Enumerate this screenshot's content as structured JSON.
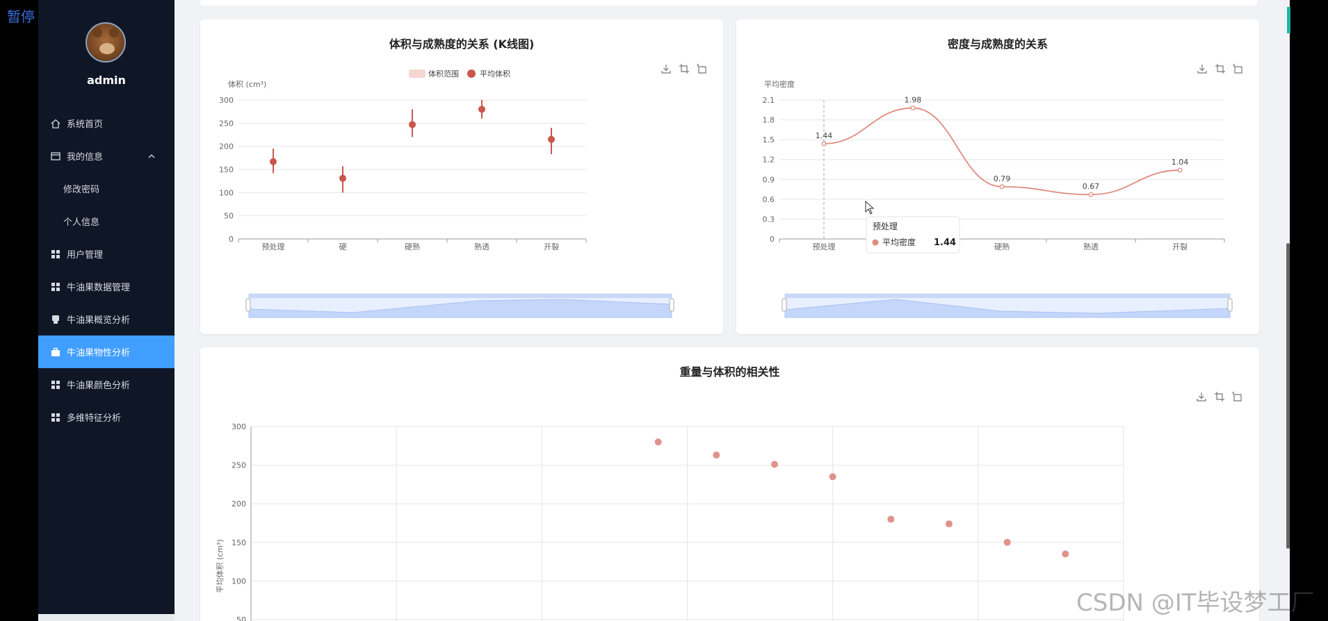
{
  "overlay": {
    "pause": "暂停",
    "watermark": "CSDN @IT毕设梦工厂"
  },
  "sidebar": {
    "username": "admin",
    "items": [
      {
        "label": "系统首页",
        "icon": "home-icon"
      },
      {
        "label": "我的信息",
        "icon": "card-icon"
      },
      {
        "label": "修改密码",
        "icon": ""
      },
      {
        "label": "个人信息",
        "icon": ""
      },
      {
        "label": "用户管理",
        "icon": "grid-icon"
      },
      {
        "label": "牛油果数据管理",
        "icon": "grid-icon"
      },
      {
        "label": "牛油果概览分析",
        "icon": "printer-icon"
      },
      {
        "label": "牛油果物性分析",
        "icon": "briefcase-icon",
        "active": true
      },
      {
        "label": "牛油果颜色分析",
        "icon": "grid-icon"
      },
      {
        "label": "多维特征分析",
        "icon": "grid-icon"
      }
    ],
    "active_color": "#409eff"
  },
  "chart_data": [
    {
      "type": "candlestick",
      "title": "体积与成熟度的关系 (K线图)",
      "ylabel": "体积 (cm³)",
      "legend": [
        "体积范围",
        "平均体积"
      ],
      "categories": [
        "预处理",
        "硬",
        "硬熟",
        "熟透",
        "开裂"
      ],
      "ylim": [
        0,
        300
      ],
      "yticks": [
        0,
        50,
        100,
        150,
        200,
        250,
        300
      ],
      "series": [
        {
          "name": "体积范围",
          "low": [
            142,
            100,
            220,
            260,
            183
          ],
          "high": [
            195,
            157,
            280,
            300,
            240
          ]
        },
        {
          "name": "平均体积",
          "values": [
            167,
            131,
            247,
            280,
            215
          ]
        }
      ],
      "color": "#c9574c"
    },
    {
      "type": "line",
      "title": "密度与成熟度的关系",
      "ylabel": "平均密度",
      "categories": [
        "预处理",
        "硬",
        "硬熟",
        "熟透",
        "开裂"
      ],
      "ylim": [
        0,
        2.1
      ],
      "yticks": [
        0,
        0.3,
        0.6,
        0.9,
        1.2,
        1.5,
        1.8,
        2.1
      ],
      "series": [
        {
          "name": "平均密度",
          "values": [
            1.44,
            1.98,
            0.79,
            0.67,
            1.04
          ]
        }
      ],
      "tooltip": {
        "category": "预处理",
        "series": "平均密度",
        "value": "1.44"
      },
      "color": "#e08b7f"
    },
    {
      "type": "scatter",
      "title": "重量与体积的相关性",
      "ylabel": "平均体积 (cm³)",
      "ylim": [
        50,
        300
      ],
      "yticks": [
        50,
        100,
        150,
        200,
        250,
        300
      ],
      "points": [
        280,
        263,
        251,
        235,
        180,
        174,
        150,
        135
      ],
      "color": "#e0928a"
    }
  ]
}
